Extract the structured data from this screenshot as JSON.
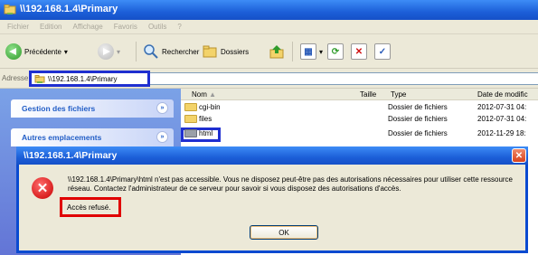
{
  "window": {
    "title": "\\\\192.168.1.4\\Primary"
  },
  "menubar": [
    "Fichier",
    "Edition",
    "Affichage",
    "Favoris",
    "Outils",
    "?"
  ],
  "toolbar": {
    "back_label": "Précédente",
    "search_label": "Rechercher",
    "folders_label": "Dossiers"
  },
  "address": {
    "label": "Adresse",
    "value": "\\\\192.168.1.4\\Primary"
  },
  "tasks": {
    "file_management": "Gestion des fichiers",
    "other_places": "Autres emplacements"
  },
  "filelist": {
    "columns": {
      "name": "Nom",
      "size": "Taille",
      "type": "Type",
      "date": "Date de modific"
    },
    "rows": [
      {
        "name": "cgi-bin",
        "size": "",
        "type": "Dossier de fichiers",
        "date": "2012-07-31 04:"
      },
      {
        "name": "files",
        "size": "",
        "type": "Dossier de fichiers",
        "date": "2012-07-31 04:"
      },
      {
        "name": "html",
        "size": "",
        "type": "Dossier de fichiers",
        "date": "2012-11-29 18:"
      }
    ]
  },
  "dialog": {
    "title": "\\\\192.168.1.4\\Primary",
    "message": "\\\\192.168.1.4\\Primary\\html n'est pas accessible. Vous ne disposez peut-être pas des autorisations nécessaires pour utiliser cette ressource réseau. Contactez l'administrateur de ce serveur pour savoir si vous disposez des autorisations d'accès.",
    "detail": "Accès refusé.",
    "ok_label": "OK"
  }
}
